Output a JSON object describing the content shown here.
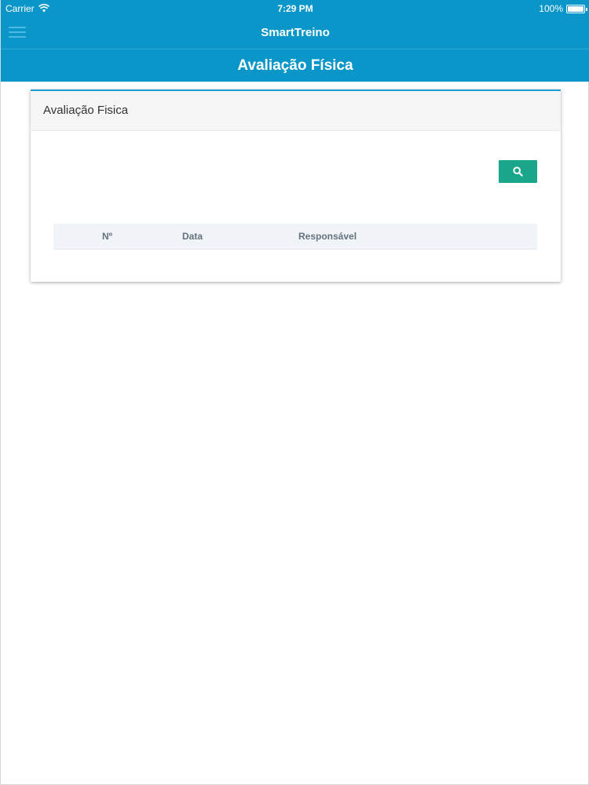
{
  "status_bar": {
    "carrier": "Carrier",
    "time": "7:29 PM",
    "battery": "100%"
  },
  "nav": {
    "app_title": "SmartTreino",
    "menu_icon": "hamburger-menu-icon"
  },
  "page": {
    "title": "Avaliação Física"
  },
  "card": {
    "title": "Avaliação Fisica",
    "search_icon": "search-icon",
    "table": {
      "columns": [
        "Nº",
        "Data",
        "Responsável"
      ],
      "rows": []
    }
  },
  "colors": {
    "primary": "#0a96c8",
    "accent": "#19a68b",
    "table_header_bg": "#f0f4f8"
  }
}
